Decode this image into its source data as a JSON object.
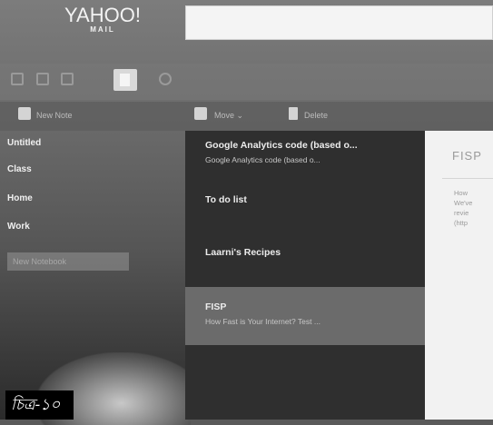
{
  "app": {
    "brand": "YAHOO!",
    "subbrand": "MAIL"
  },
  "search": {
    "placeholder": "",
    "value": ""
  },
  "appbar": {
    "icons": [
      "mail-icon",
      "contacts-icon",
      "calendar-icon",
      "notepad-icon",
      "settings-icon"
    ],
    "active": "notepad-icon"
  },
  "toolbar": {
    "new_note": "New Note",
    "move": "Move ⌄",
    "delete": "Delete"
  },
  "sidebar": {
    "items": [
      {
        "label": "Untitled"
      },
      {
        "label": "Class"
      },
      {
        "label": "Home"
      },
      {
        "label": "Work"
      }
    ],
    "new_notebook_placeholder": "New Notebook"
  },
  "notes": [
    {
      "title": "Google Analytics code (based o...",
      "snippet": "Google Analytics code (based o...",
      "selected": false
    },
    {
      "title": "To do list",
      "snippet": "",
      "selected": false
    },
    {
      "title": "Laarni's Recipes",
      "snippet": "",
      "selected": false
    },
    {
      "title": "FISP",
      "snippet": "How Fast is Your Internet? Test ...",
      "selected": true
    }
  ],
  "content": {
    "title": "FISP",
    "lines": [
      "How",
      "We've",
      "revie",
      "(http"
    ]
  },
  "figure_label": "চিত্র-১০"
}
